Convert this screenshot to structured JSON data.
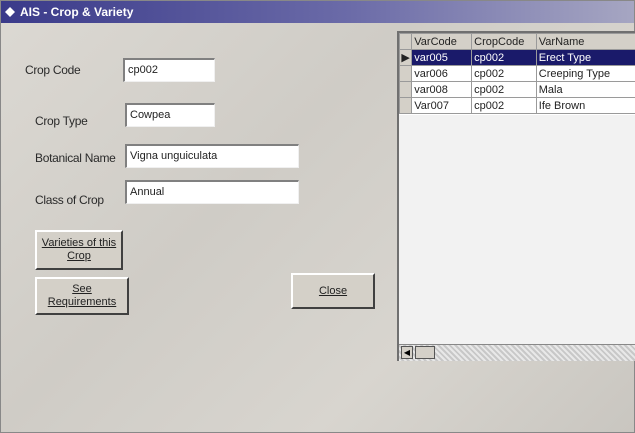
{
  "window": {
    "title": "AIS - Crop & Variety"
  },
  "form": {
    "crop_code": {
      "label": "Crop Code",
      "value": "cp002"
    },
    "crop_type": {
      "label": "Crop Type",
      "value": "Cowpea"
    },
    "botanical_name": {
      "label": "Botanical Name",
      "value": "Vigna unguiculata"
    },
    "class_of_crop": {
      "label": "Class of Crop",
      "value": "Annual"
    }
  },
  "buttons": {
    "varieties_line1": "Varieties of this",
    "varieties_line2": "Crop",
    "requirements_line1": "See",
    "requirements_line2": "Requirements",
    "close": "Close"
  },
  "grid": {
    "columns": [
      "VarCode",
      "CropCode",
      "VarName"
    ],
    "rows": [
      [
        "var005",
        "cp002",
        "Erect Type"
      ],
      [
        "var006",
        "cp002",
        "Creeping Type"
      ],
      [
        "var008",
        "cp002",
        "Mala"
      ],
      [
        "Var007",
        "cp002",
        "Ife Brown"
      ]
    ],
    "selected_row": 0,
    "row_indicator": "▶"
  },
  "colors": {
    "title_bar": "#3a3a8a",
    "selection": "#1a1a6a"
  }
}
